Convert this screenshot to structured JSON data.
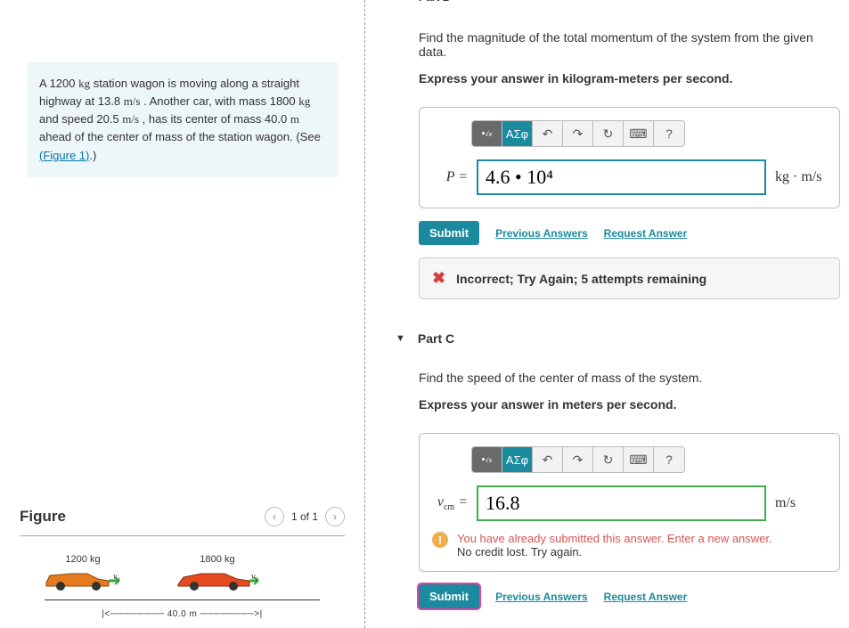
{
  "problem": {
    "text_parts": {
      "p1": "A 1200 ",
      "kg1": "kg",
      "p2": " station wagon is moving along a straight highway at 13.8 ",
      "ms1": "m/s",
      "p3": " . Another car, with mass 1800 ",
      "kg2": "kg",
      "p4": " and speed 20.5 ",
      "ms2": "m/s",
      "p5": " , has its center of mass 40.0 ",
      "m1": "m",
      "p6": " ahead of the center of mass of the station wagon. (See ",
      "figlink": "(Figure 1)",
      "p7": ".)"
    }
  },
  "figure": {
    "title": "Figure",
    "pager": "1 of 1",
    "label_car1": "1200 kg",
    "label_car2": "1800 kg",
    "v1": "v₁",
    "v2": "v₂",
    "distance": "40.0 m"
  },
  "partB": {
    "truncated_title": "Part B",
    "question": "Find the magnitude of the total momentum of the system from the given data.",
    "instruction": "Express your answer in kilogram-meters per second.",
    "toolbar": {
      "template": "√x",
      "greek": "ΑΣφ",
      "undo": "↶",
      "redo": "↷",
      "reset": "↻",
      "keyboard": "⌨",
      "help": "?"
    },
    "eq_label": "P =",
    "answer_value": "4.6 • 10⁴",
    "units": "kg · m/s",
    "submit": "Submit",
    "prev_answers": "Previous Answers",
    "request_answer": "Request Answer",
    "feedback": "Incorrect; Try Again; 5 attempts remaining"
  },
  "partC": {
    "title": "Part C",
    "question": "Find the speed of the center of mass of the system.",
    "instruction": "Express your answer in meters per second.",
    "toolbar": {
      "template": "√x",
      "greek": "ΑΣφ",
      "undo": "↶",
      "redo": "↷",
      "reset": "↻",
      "keyboard": "⌨",
      "help": "?"
    },
    "eq_label_html": "vcm =",
    "answer_value": "16.8",
    "units": "m/s",
    "info_line1": "You have already submitted this answer. Enter a new answer.",
    "info_line2": "No credit lost. Try again.",
    "submit": "Submit",
    "prev_answers": "Previous Answers",
    "request_answer": "Request Answer"
  }
}
